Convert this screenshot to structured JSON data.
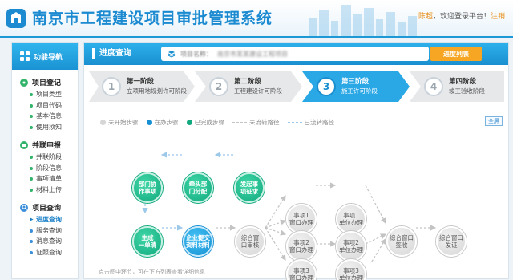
{
  "header": {
    "title": "南京市工程建设项目审批管理系统",
    "user_name": "陈超",
    "welcome_text": "，欢迎登录平台！",
    "logout": "注销"
  },
  "sidebar": {
    "title": "功能导航",
    "sections": [
      {
        "title": "项目登记",
        "items": [
          "项目类型",
          "项目代码",
          "基本信息",
          "使用须知"
        ]
      },
      {
        "title": "并联申报",
        "items": [
          "并联阶段",
          "阶段信息",
          "事项清单",
          "材料上传"
        ]
      },
      {
        "title": "项目查询",
        "items": [
          "进度查询",
          "服务查询",
          "消息查询",
          "证照查询"
        ]
      }
    ],
    "active_item": "进度查询"
  },
  "main": {
    "title": "进度查询",
    "project_label": "项目名称：",
    "project_value": "南京市某某建设工程项目",
    "progress_button": "进度列表",
    "fullscreen": "全屏",
    "stages": [
      {
        "num": "1",
        "name": "第一阶段",
        "desc": "立项用地规划许可阶段"
      },
      {
        "num": "2",
        "name": "第二阶段",
        "desc": "工程建设许可阶段"
      },
      {
        "num": "3",
        "name": "第三阶段",
        "desc": "施工许可阶段"
      },
      {
        "num": "4",
        "name": "第四阶段",
        "desc": "竣工验收阶段"
      }
    ],
    "legend": {
      "not_started": "未开始步骤",
      "in_progress": "在办步骤",
      "done": "已完成步骤",
      "path_pending": "未流转路径",
      "path_done": "已流转路径"
    },
    "flow": {
      "n1": "部门协\n作事项",
      "n2": "牵头部\n门分配",
      "n3": "发起事\n项征求",
      "n4": "生成\n一单清",
      "n5": "企业提交\n资料材料",
      "n6": "综合窗\n口审核",
      "w1": "事项1\n窗口办理",
      "w2": "事项2\n窗口办理",
      "w3": "事项3\n窗口办理",
      "u1": "事项1\n单位办理",
      "u2": "事项2\n单位办理",
      "u3": "事项3\n单位办理",
      "sign": "综合窗口\n签收",
      "issue": "综合窗口\n发证"
    },
    "hint": "点击图中环节，可在下方列表查看详细信息",
    "colors": {
      "green": "#12a97f",
      "blue": "#1690d3",
      "grey": "#d6d6d6",
      "accent": "#f6a623"
    }
  }
}
